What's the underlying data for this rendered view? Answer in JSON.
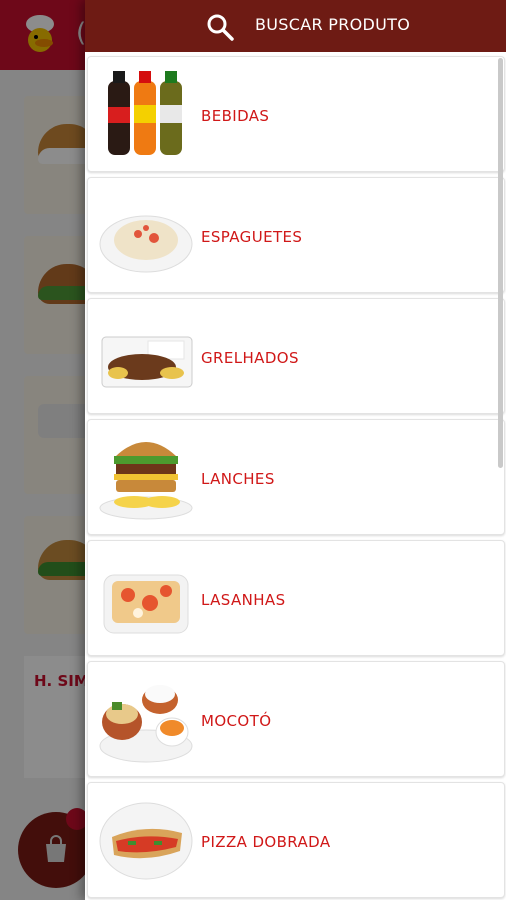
{
  "drawer": {
    "search": {
      "label": "BUSCAR PRODUTO",
      "icon": "search-icon"
    },
    "categories": [
      {
        "label": "BEBIDAS",
        "icon": "soda-bottles-image"
      },
      {
        "label": "ESPAGUETES",
        "icon": "spaghetti-plate-image"
      },
      {
        "label": "GRELHADOS",
        "icon": "grilled-meat-tray-image"
      },
      {
        "label": "LANCHES",
        "icon": "burger-image"
      },
      {
        "label": "LASANHAS",
        "icon": "lasagna-dish-image"
      },
      {
        "label": "MOCOTÓ",
        "icon": "mocoto-bowls-image"
      },
      {
        "label": "PIZZA DOBRADA",
        "icon": "folded-pizza-image"
      }
    ]
  },
  "background": {
    "visible_text": "H. SIMF",
    "cart_icon": "shopping-bag-icon"
  },
  "colors": {
    "drawer_header": "#6e1b14",
    "app_header": "#c8102e",
    "category_text": "#d01818"
  }
}
